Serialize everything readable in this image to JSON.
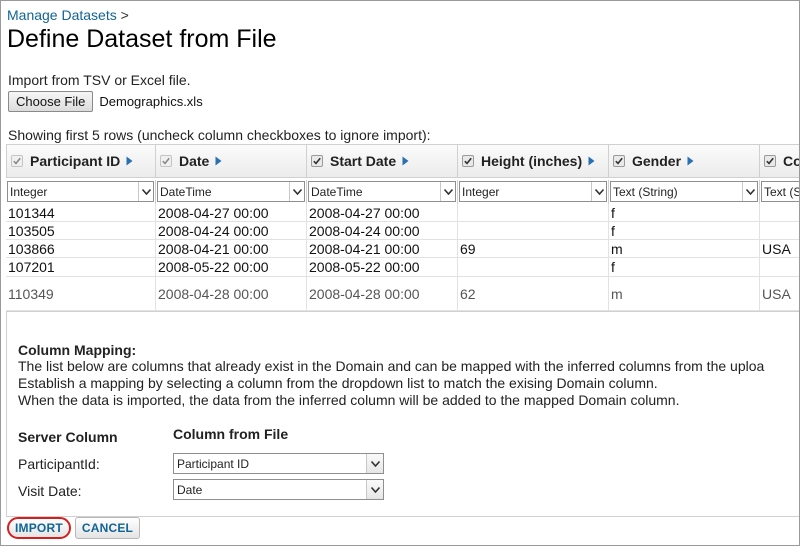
{
  "breadcrumb": {
    "link": "Manage Datasets",
    "separator": ">"
  },
  "page": {
    "title": "Define Dataset from File",
    "import_instructions": "Import from TSV or Excel file.",
    "choose_file_label": "Choose File",
    "file_name": "Demographics.xls",
    "showing_text": "Showing first 5 rows (uncheck column checkboxes to ignore import):"
  },
  "preview": {
    "columns": [
      {
        "label": "Participant ID",
        "type": "Integer",
        "checked": true,
        "disabled": true
      },
      {
        "label": "Date",
        "type": "DateTime",
        "checked": true,
        "disabled": true
      },
      {
        "label": "Start Date",
        "type": "DateTime",
        "checked": true,
        "disabled": false
      },
      {
        "label": "Height (inches)",
        "type": "Integer",
        "checked": true,
        "disabled": false
      },
      {
        "label": "Gender",
        "type": "Text (String)",
        "checked": true,
        "disabled": false
      },
      {
        "label": "Co",
        "type": "Text (S",
        "checked": true,
        "disabled": false
      }
    ],
    "rows": [
      [
        "101344",
        "2008-04-27 00:00",
        "2008-04-27 00:00",
        "",
        "f",
        ""
      ],
      [
        "103505",
        "2008-04-24 00:00",
        "2008-04-24 00:00",
        "",
        "f",
        ""
      ],
      [
        "103866",
        "2008-04-21 00:00",
        "2008-04-21 00:00",
        "69",
        "m",
        "USA"
      ],
      [
        "107201",
        "2008-05-22 00:00",
        "2008-05-22 00:00",
        "",
        "f",
        ""
      ],
      [
        "110349",
        "2008-04-28 00:00",
        "2008-04-28 00:00",
        "62",
        "m",
        "USA"
      ]
    ]
  },
  "mapping": {
    "title": "Column Mapping:",
    "description": [
      "The list below are columns that already exist in the Domain and can be mapped with the inferred columns from the uploa",
      "Establish a mapping by selecting a column from the dropdown list to match the exising Domain column.",
      "When the data is imported, the data from the inferred column will be added to the mapped Domain column."
    ],
    "header_server": "Server Column",
    "header_file": "Column from File",
    "rows": [
      {
        "server": "ParticipantId:",
        "file": "Participant ID"
      },
      {
        "server": "Visit Date:",
        "file": "Date"
      }
    ]
  },
  "buttons": {
    "import": "IMPORT",
    "cancel": "CANCEL"
  },
  "colors": {
    "link": "#126495",
    "highlight": "#d41f1f"
  }
}
